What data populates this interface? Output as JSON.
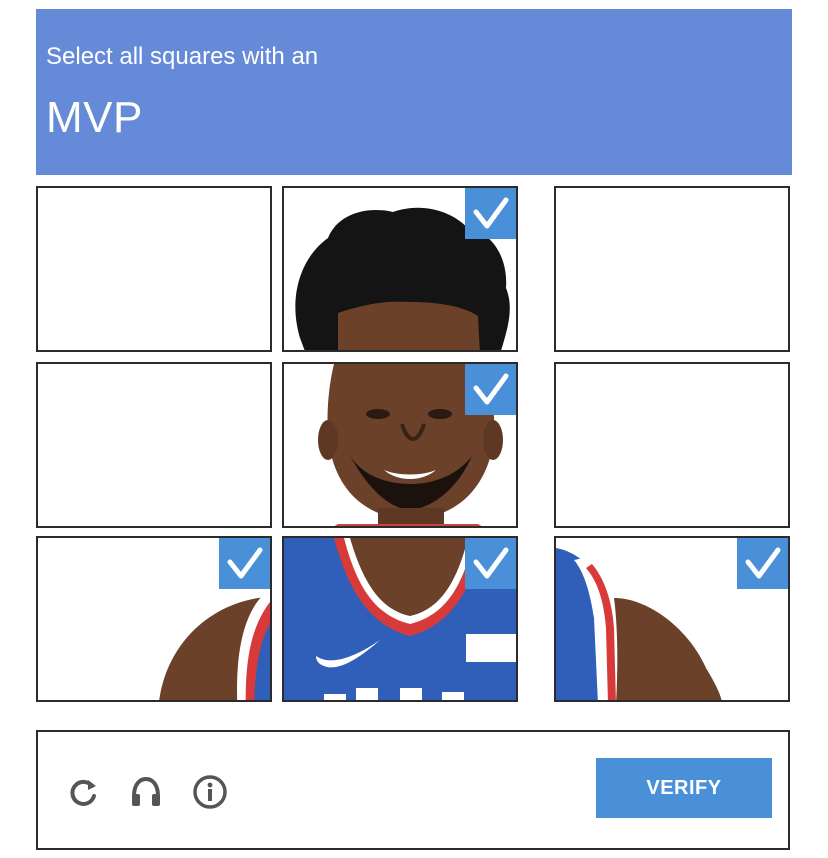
{
  "header": {
    "instruction": "Select all squares with an",
    "target": "MVP",
    "color": "#658bd8"
  },
  "tiles": [
    {
      "row": 1,
      "col": 1,
      "selected": false
    },
    {
      "row": 1,
      "col": 2,
      "selected": true
    },
    {
      "row": 1,
      "col": 3,
      "selected": false
    },
    {
      "row": 2,
      "col": 1,
      "selected": false
    },
    {
      "row": 2,
      "col": 2,
      "selected": true
    },
    {
      "row": 2,
      "col": 3,
      "selected": false
    },
    {
      "row": 3,
      "col": 1,
      "selected": true
    },
    {
      "row": 3,
      "col": 2,
      "selected": true
    },
    {
      "row": 3,
      "col": 3,
      "selected": true
    }
  ],
  "image": {
    "description_icon": "basketball-player-photo",
    "jersey_colors": {
      "blue": "#2f5fb8",
      "red": "#d83a3a",
      "skin": "#6b4028",
      "hair": "#151515"
    }
  },
  "footer": {
    "icons": [
      "reload-icon",
      "headphones-icon",
      "info-icon"
    ],
    "verify_label": "VERIFY",
    "accent": "#4a90d9"
  }
}
